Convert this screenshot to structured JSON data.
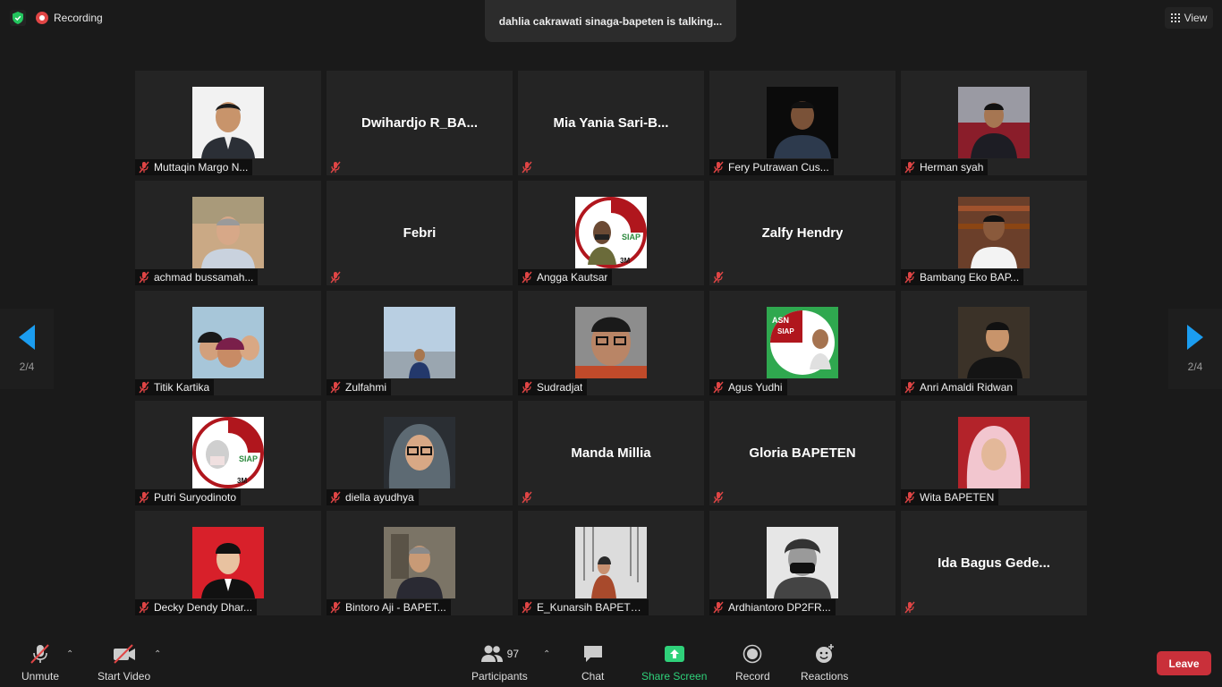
{
  "top": {
    "recording_label": "Recording",
    "talking": "dahlia cakrawati sinaga-bapeten is talking...",
    "view_label": "View"
  },
  "nav": {
    "left_page": "2/4",
    "right_page": "2/4"
  },
  "tiles": [
    {
      "label": "Muttaqin Margo N...",
      "big": "",
      "photo": "suit-man"
    },
    {
      "label": "",
      "big": "Dwihardjo  R_BA...",
      "photo": ""
    },
    {
      "label": "",
      "big": "Mia  Yania  Sari-B...",
      "photo": ""
    },
    {
      "label": "Fery Putrawan Cus...",
      "big": "",
      "photo": "dark-man"
    },
    {
      "label": "Herman syah",
      "big": "",
      "photo": "red-man"
    },
    {
      "label": "achmad bussamah...",
      "big": "",
      "photo": "office-man"
    },
    {
      "label": "",
      "big": "Febri",
      "photo": ""
    },
    {
      "label": "Angga Kautsar",
      "big": "",
      "photo": "siap-badge"
    },
    {
      "label": "",
      "big": "Zalfy Hendry",
      "photo": ""
    },
    {
      "label": "Bambang Eko BAP...",
      "big": "",
      "photo": "library-man"
    },
    {
      "label": "Titik Kartika",
      "big": "",
      "photo": "family"
    },
    {
      "label": "Zulfahmi",
      "big": "",
      "photo": "airport-man"
    },
    {
      "label": "Sudradjat",
      "big": "",
      "photo": "glasses-man"
    },
    {
      "label": "Agus Yudhi",
      "big": "",
      "photo": "asn-badge"
    },
    {
      "label": "Anri Amaldi Ridwan",
      "big": "",
      "photo": "car-man"
    },
    {
      "label": "Putri Suryodinoto",
      "big": "",
      "photo": "siap-badge-woman"
    },
    {
      "label": "diella ayudhya",
      "big": "",
      "photo": "hijab-glasses"
    },
    {
      "label": "",
      "big": "Manda Millia",
      "photo": ""
    },
    {
      "label": "",
      "big": "Gloria BAPETEN",
      "photo": ""
    },
    {
      "label": "Wita BAPETEN",
      "big": "",
      "photo": "hijab-pink"
    },
    {
      "label": "Decky Dendy Dhar...",
      "big": "",
      "photo": "red-portrait"
    },
    {
      "label": "Bintoro Aji - BAPET...",
      "big": "",
      "photo": "office-old"
    },
    {
      "label": "E_Kunarsih BAPETEN",
      "big": "",
      "photo": "snow-woman"
    },
    {
      "label": "Ardhiantoro DP2FR...",
      "big": "",
      "photo": "bw-mask"
    },
    {
      "label": "",
      "big": "Ida  Bagus  Gede...",
      "photo": ""
    }
  ],
  "toolbar": {
    "unmute": "Unmute",
    "start_video": "Start Video",
    "participants": "Participants",
    "participant_count": "97",
    "chat": "Chat",
    "share_screen": "Share Screen",
    "record": "Record",
    "reactions": "Reactions",
    "leave": "Leave"
  },
  "colors": {
    "accent_blue": "#1b9df0",
    "share_green": "#2fd17a",
    "leave_red": "#c9303a",
    "muted_red": "#e04545"
  }
}
